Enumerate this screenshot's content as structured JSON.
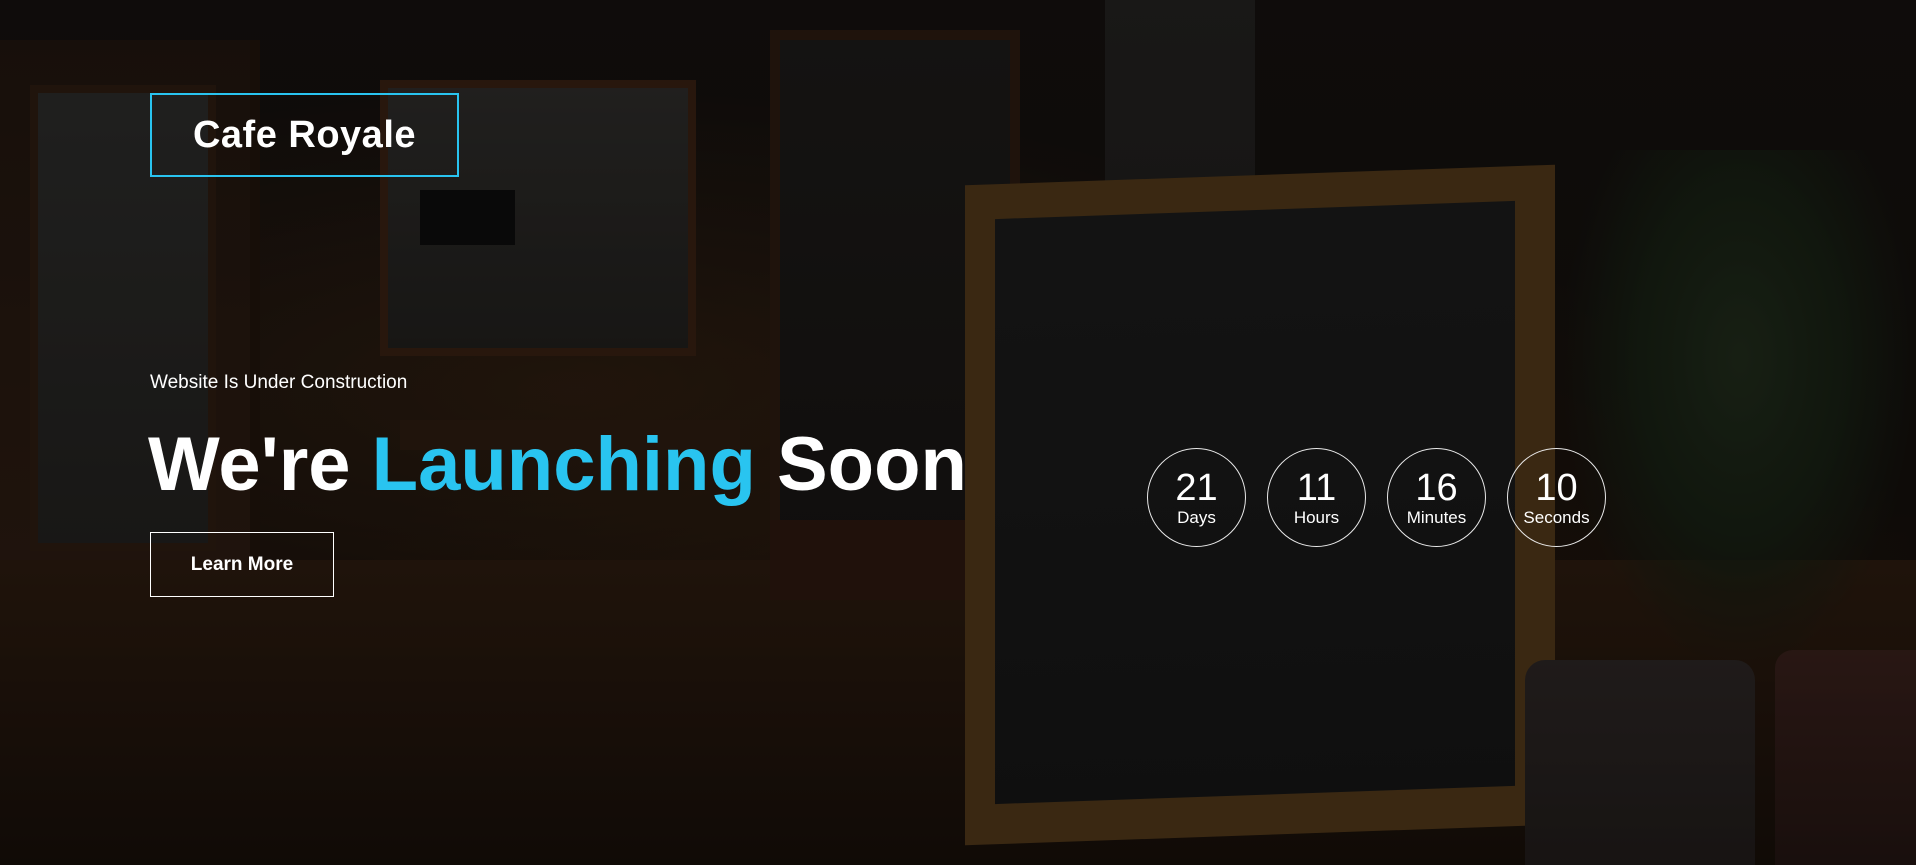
{
  "brand": {
    "title": "Cafe Royale"
  },
  "hero": {
    "subtitle": "Website Is Under Construction",
    "headline_start": "We're ",
    "headline_accent": "Launching",
    "headline_end": " Soon",
    "cta_label": "Learn More"
  },
  "countdown": [
    {
      "value": "21",
      "label": "Days"
    },
    {
      "value": "11",
      "label": "Hours"
    },
    {
      "value": "16",
      "label": "Minutes"
    },
    {
      "value": "10",
      "label": "Seconds"
    }
  ],
  "colors": {
    "accent": "#29c4f0",
    "text": "#ffffff"
  }
}
